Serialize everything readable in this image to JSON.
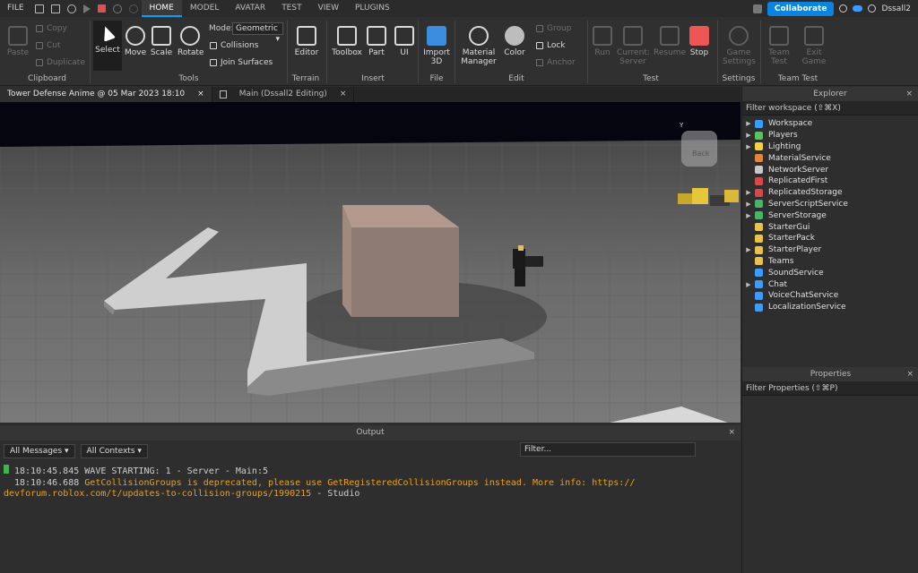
{
  "menubar": {
    "file": "FILE",
    "tabs": [
      "HOME",
      "MODEL",
      "AVATAR",
      "TEST",
      "VIEW",
      "PLUGINS"
    ],
    "collaborate": "Collaborate",
    "user": "Dssall2"
  },
  "ribbon": {
    "clipboard": {
      "paste": "Paste",
      "copy": "Copy",
      "cut": "Cut",
      "duplicate": "Duplicate",
      "group": "Clipboard"
    },
    "tools": {
      "select": "Select",
      "move": "Move",
      "scale": "Scale",
      "rotate": "Rotate",
      "mode_label": "Mode:",
      "mode_value": "Geometric",
      "collisions": "Collisions",
      "join_surfaces": "Join Surfaces",
      "group": "Tools"
    },
    "terrain": {
      "editor": "Editor",
      "group": "Terrain"
    },
    "insert": {
      "toolbox": "Toolbox",
      "part": "Part",
      "ui": "UI",
      "group": "Insert"
    },
    "file": {
      "import3d_a": "Import",
      "import3d_b": "3D",
      "group": "File"
    },
    "edit": {
      "material_a": "Material",
      "material_b": "Manager",
      "color": "Color",
      "group_btn": "Group",
      "lock": "Lock",
      "anchor": "Anchor",
      "group": "Edit"
    },
    "test": {
      "run": "Run",
      "current_a": "Current:",
      "current_b": "Server",
      "resume": "Resume",
      "stop": "Stop",
      "group": "Test"
    },
    "settings": {
      "game_a": "Game",
      "game_b": "Settings",
      "group": "Settings"
    },
    "teamtest": {
      "team_a": "Team",
      "team_b": "Test",
      "exit_a": "Exit",
      "exit_b": "Game",
      "group": "Team Test"
    }
  },
  "doc_tabs": [
    "Tower Defense Anime @ 05 Mar 2023 18:10",
    "Main (Dssall2 Editing)"
  ],
  "output": {
    "title": "Output",
    "messages_filter": "All Messages",
    "contexts_filter": "All Contexts",
    "filter_placeholder": "Filter...",
    "lines": [
      {
        "time": "18:10:45.845",
        "text": "WAVE STARTING: 1  -  Server - Main:5",
        "type": "info"
      },
      {
        "time": "18:10:46.688",
        "text": "GetCollisionGroups is deprecated, please use GetRegisteredCollisionGroups instead. More info: https://",
        "cont": "devforum.roblox.com/t/updates-to-collision-groups/1990215",
        "suffix": "  -  Studio",
        "type": "warn"
      }
    ]
  },
  "explorer": {
    "title": "Explorer",
    "filter": "Filter workspace (⇧⌘X)",
    "items": [
      {
        "label": "Workspace",
        "color": "#3b9cff",
        "expand": true
      },
      {
        "label": "Players",
        "color": "#58c45a",
        "expand": true
      },
      {
        "label": "Lighting",
        "color": "#f5d142",
        "expand": true
      },
      {
        "label": "MaterialService",
        "color": "#e0873a",
        "expand": false
      },
      {
        "label": "NetworkServer",
        "color": "#c8c8c8",
        "expand": false
      },
      {
        "label": "ReplicatedFirst",
        "color": "#d24a4a",
        "expand": false
      },
      {
        "label": "ReplicatedStorage",
        "color": "#d24a4a",
        "expand": true
      },
      {
        "label": "ServerScriptService",
        "color": "#4ab36a",
        "expand": true
      },
      {
        "label": "ServerStorage",
        "color": "#4ab36a",
        "expand": true
      },
      {
        "label": "StarterGui",
        "color": "#e8c24a",
        "expand": false
      },
      {
        "label": "StarterPack",
        "color": "#e8c24a",
        "expand": false
      },
      {
        "label": "StarterPlayer",
        "color": "#e8c24a",
        "expand": true
      },
      {
        "label": "Teams",
        "color": "#e8c24a",
        "expand": false
      },
      {
        "label": "SoundService",
        "color": "#3b9cff",
        "expand": false
      },
      {
        "label": "Chat",
        "color": "#3b9cff",
        "expand": true
      },
      {
        "label": "VoiceChatService",
        "color": "#3b9cff",
        "expand": false
      },
      {
        "label": "LocalizationService",
        "color": "#3b9cff",
        "expand": false
      }
    ]
  },
  "properties": {
    "title": "Properties",
    "filter": "Filter Properties (⇧⌘P)"
  },
  "viewport": {
    "back_label": "Back",
    "axis_label": "Y"
  }
}
